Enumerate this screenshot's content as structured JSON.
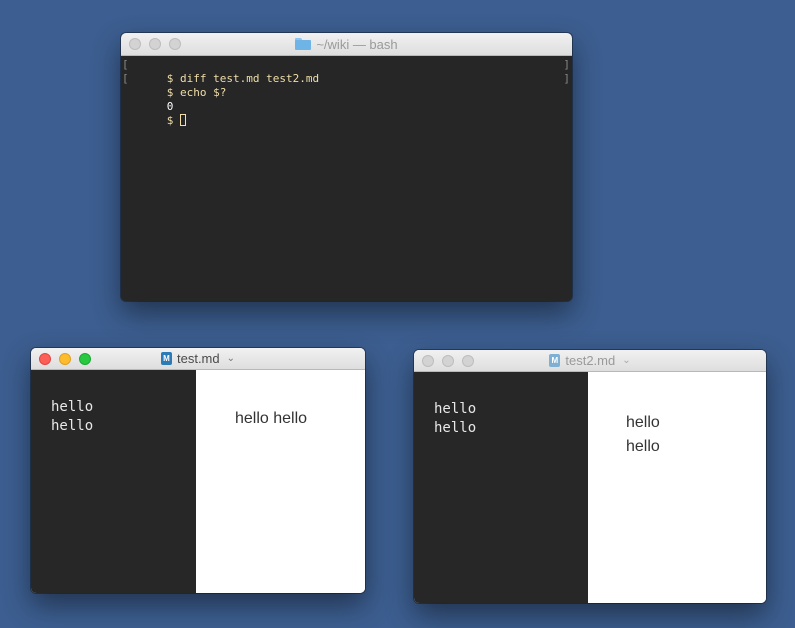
{
  "terminal": {
    "title": "~/wiki — bash",
    "lines": [
      {
        "bracket_left": "[",
        "text": "$ diff test.md test2.md",
        "bracket_right": "]"
      },
      {
        "bracket_left": "[",
        "text": "$ echo $?",
        "bracket_right": "]"
      },
      {
        "text": "0"
      },
      {
        "text": "$ "
      }
    ]
  },
  "editor1": {
    "title": "test.md",
    "source_lines": [
      "hello",
      "hello"
    ],
    "preview_lines": [
      "hello hello"
    ]
  },
  "editor2": {
    "title": "test2.md",
    "source_lines": [
      "hello",
      "hello"
    ],
    "preview_lines": [
      "hello",
      "hello"
    ]
  },
  "colors": {
    "desktop": "#3c5e90",
    "terminal_bg": "#262626",
    "terminal_text": "#f0dfa9",
    "editor_source_bg": "#272727"
  }
}
